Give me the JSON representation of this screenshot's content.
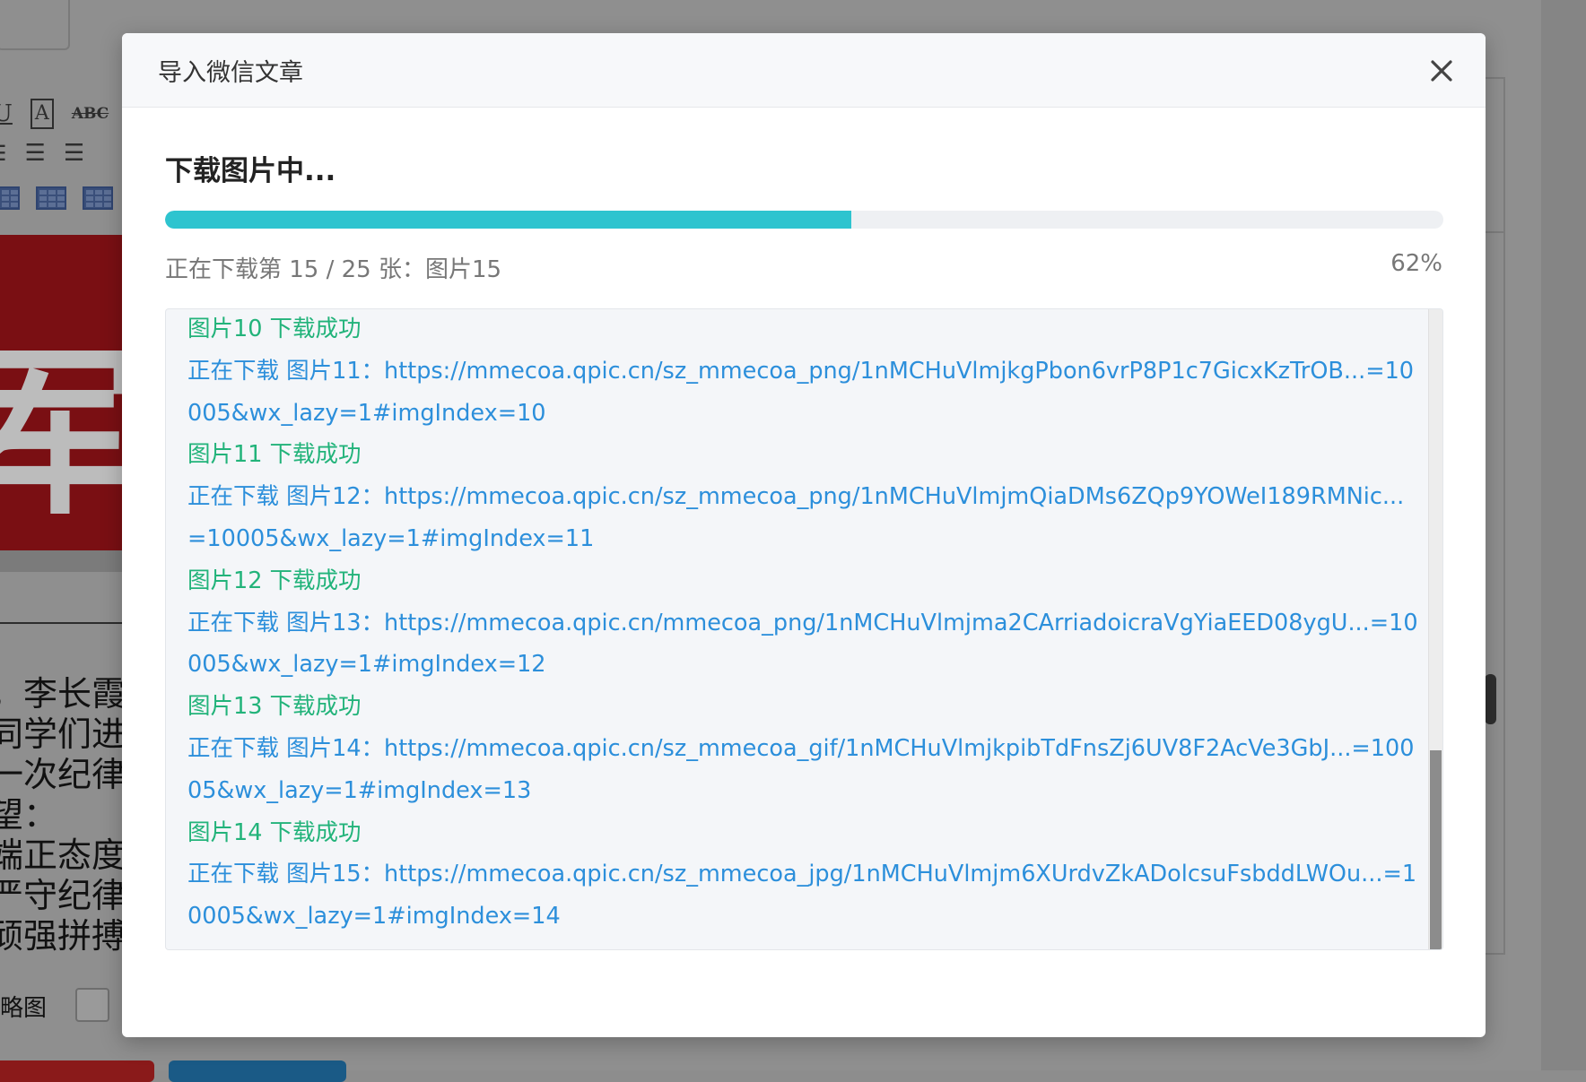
{
  "background": {
    "toolbar_icons": [
      "U",
      "A",
      "ABC"
    ],
    "image_char": "军",
    "text_lines": [
      "，李长霞",
      "同学们进",
      "一次纪律",
      "望：",
      "端正态度",
      "严守纪律",
      "顽强拼搏"
    ],
    "checkbox_label": "略图"
  },
  "modal": {
    "title": "导入微信文章",
    "status_title": "下载图片中...",
    "progress": {
      "percent_value": 0.62,
      "percent_label": "62%",
      "status_text": "正在下载第 15 / 25 张：图片15"
    },
    "log": [
      {
        "type": "ok",
        "text": "图片10 下载成功"
      },
      {
        "type": "info",
        "text": "正在下载 图片11：https://mmecoa.qpic.cn/sz_mmecoa_png/1nMCHuVlmjkgPbon6vrP8P1c7GicxKzTrOB...=10005&wx_lazy=1#imgIndex=10"
      },
      {
        "type": "ok",
        "text": "图片11 下载成功"
      },
      {
        "type": "info",
        "text": "正在下载 图片12：https://mmecoa.qpic.cn/sz_mmecoa_png/1nMCHuVlmjmQiaDMs6ZQp9YOWeI189RMNic...=10005&wx_lazy=1#imgIndex=11"
      },
      {
        "type": "ok",
        "text": "图片12 下载成功"
      },
      {
        "type": "info",
        "text": "正在下载 图片13：https://mmecoa.qpic.cn/mmecoa_png/1nMCHuVlmjma2CArriadoicraVgYiaEED08ygU...=10005&wx_lazy=1#imgIndex=12"
      },
      {
        "type": "ok",
        "text": "图片13 下载成功"
      },
      {
        "type": "info",
        "text": "正在下载 图片14：https://mmecoa.qpic.cn/sz_mmecoa_gif/1nMCHuVlmjkpibTdFnsZj6UV8F2AcVe3GbJ...=10005&wx_lazy=1#imgIndex=13"
      },
      {
        "type": "ok",
        "text": "图片14 下载成功"
      },
      {
        "type": "info",
        "text": "正在下载 图片15：https://mmecoa.qpic.cn/sz_mmecoa_jpg/1nMCHuVlmjm6XUrdvZkADolcsuFsbddLWOu...=10005&wx_lazy=1#imgIndex=14"
      }
    ]
  },
  "colors": {
    "progress_fill": "#2ec4cf",
    "log_success": "#22b37a",
    "log_info": "#2c8fdb"
  },
  "icons": {
    "close": "close-icon"
  }
}
